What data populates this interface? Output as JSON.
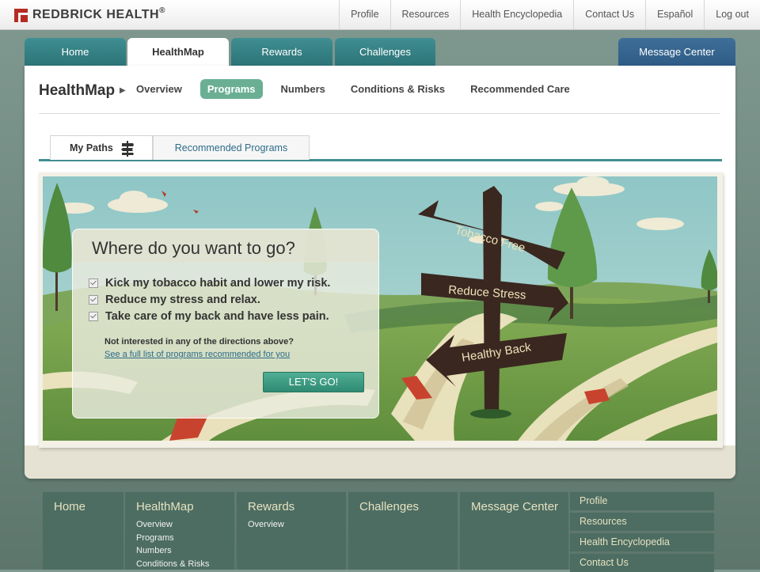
{
  "brand": {
    "name": "REDBRICK HEALTH",
    "reg": "®"
  },
  "topnav": [
    "Profile",
    "Resources",
    "Health Encyclopedia",
    "Contact Us",
    "Español",
    "Log out"
  ],
  "tabs": [
    "Home",
    "HealthMap",
    "Rewards",
    "Challenges"
  ],
  "message_center": "Message Center",
  "healthmap": {
    "title": "HealthMap",
    "subnav": [
      "Overview",
      "Programs",
      "Numbers",
      "Conditions & Risks",
      "Recommended Care"
    ],
    "active_subnav": "Programs"
  },
  "program_tabs": {
    "my_paths": "My Paths",
    "recommended": "Recommended Programs"
  },
  "signpost": {
    "sign1": "Tobacco Free",
    "sign2": "Reduce Stress",
    "sign3": "Healthy Back"
  },
  "panel": {
    "title": "Where do you want to go?",
    "items": [
      "Kick my tobacco habit and lower my risk.",
      "Reduce my stress and relax.",
      "Take care of my back and have less pain."
    ],
    "note": "Not interested in any of the directions above?",
    "link": "See a full list of programs recommended for you",
    "button": "LET'S GO!"
  },
  "footer": {
    "columns": [
      {
        "title": "Home",
        "links": []
      },
      {
        "title": "HealthMap",
        "links": [
          "Overview",
          "Programs",
          "Numbers",
          "Conditions & Risks"
        ]
      },
      {
        "title": "Rewards",
        "links": [
          "Overview"
        ]
      },
      {
        "title": "Challenges",
        "links": []
      },
      {
        "title": "Message Center",
        "links": []
      }
    ],
    "side_links": [
      "Profile",
      "Resources",
      "Health Encyclopedia",
      "Contact Us"
    ]
  },
  "colors": {
    "brand_red": "#b52b23",
    "teal_tab": "#2c7478",
    "blue_tab": "#2d5b86",
    "program_active": "#6aaf94",
    "footer_bg": "#4d6d62"
  }
}
